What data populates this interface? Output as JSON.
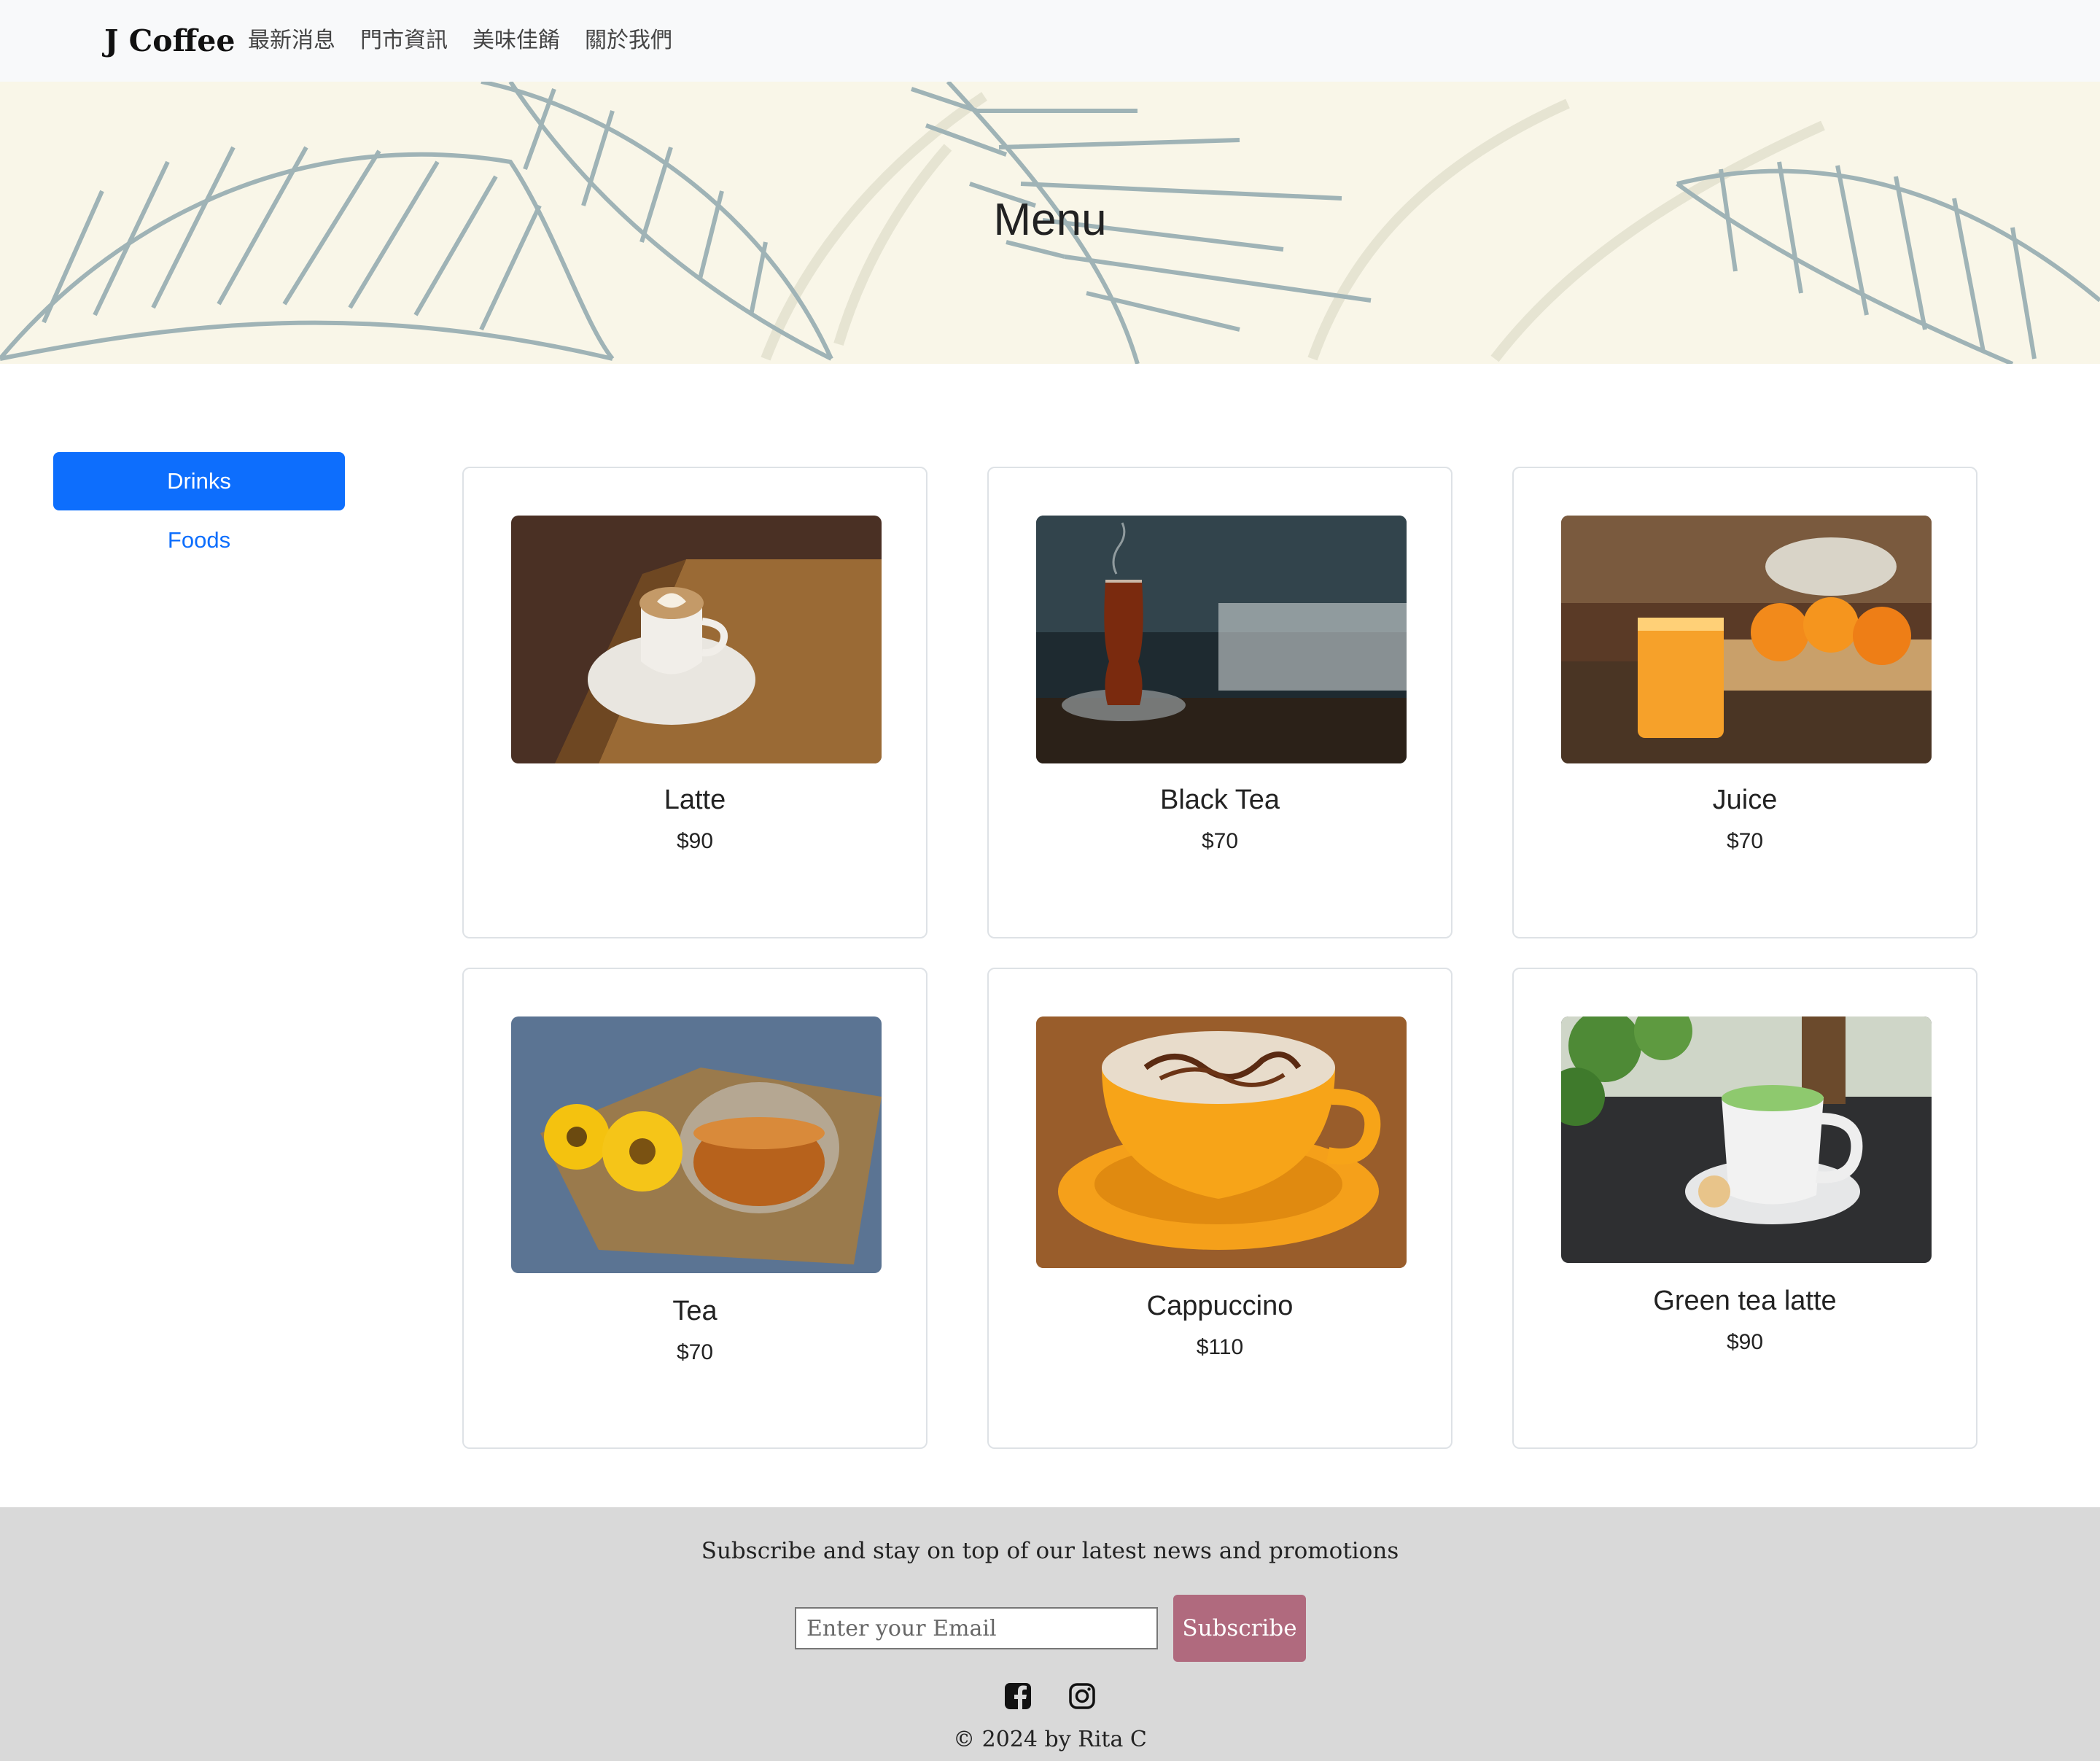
{
  "navbar": {
    "brand": "J Coffee",
    "links": [
      "最新消息",
      "門市資訊",
      "美味佳餚",
      "關於我們"
    ]
  },
  "hero": {
    "title": "Menu"
  },
  "sidebar": {
    "active": "Drinks",
    "other": "Foods"
  },
  "products": [
    {
      "name": "Latte",
      "price": "$90"
    },
    {
      "name": "Black Tea",
      "price": "$70"
    },
    {
      "name": "Juice",
      "price": "$70"
    },
    {
      "name": "Tea",
      "price": "$70"
    },
    {
      "name": "Cappuccino",
      "price": "$110"
    },
    {
      "name": "Green tea latte",
      "price": "$90"
    }
  ],
  "footer": {
    "tagline": "Subscribe and stay on top of our latest news and promotions",
    "email_placeholder": "Enter your Email",
    "subscribe_label": "Subscribe",
    "copyright": "© 2024 by Rita C",
    "icons": [
      "facebook-icon",
      "instagram-icon"
    ]
  },
  "colors": {
    "primary": "#0d6efd",
    "subscribe": "#b06a7e",
    "hero_bg": "#f9f6e8",
    "leaf": "#9fb3b6",
    "footer_bg": "#d9d9d9"
  }
}
